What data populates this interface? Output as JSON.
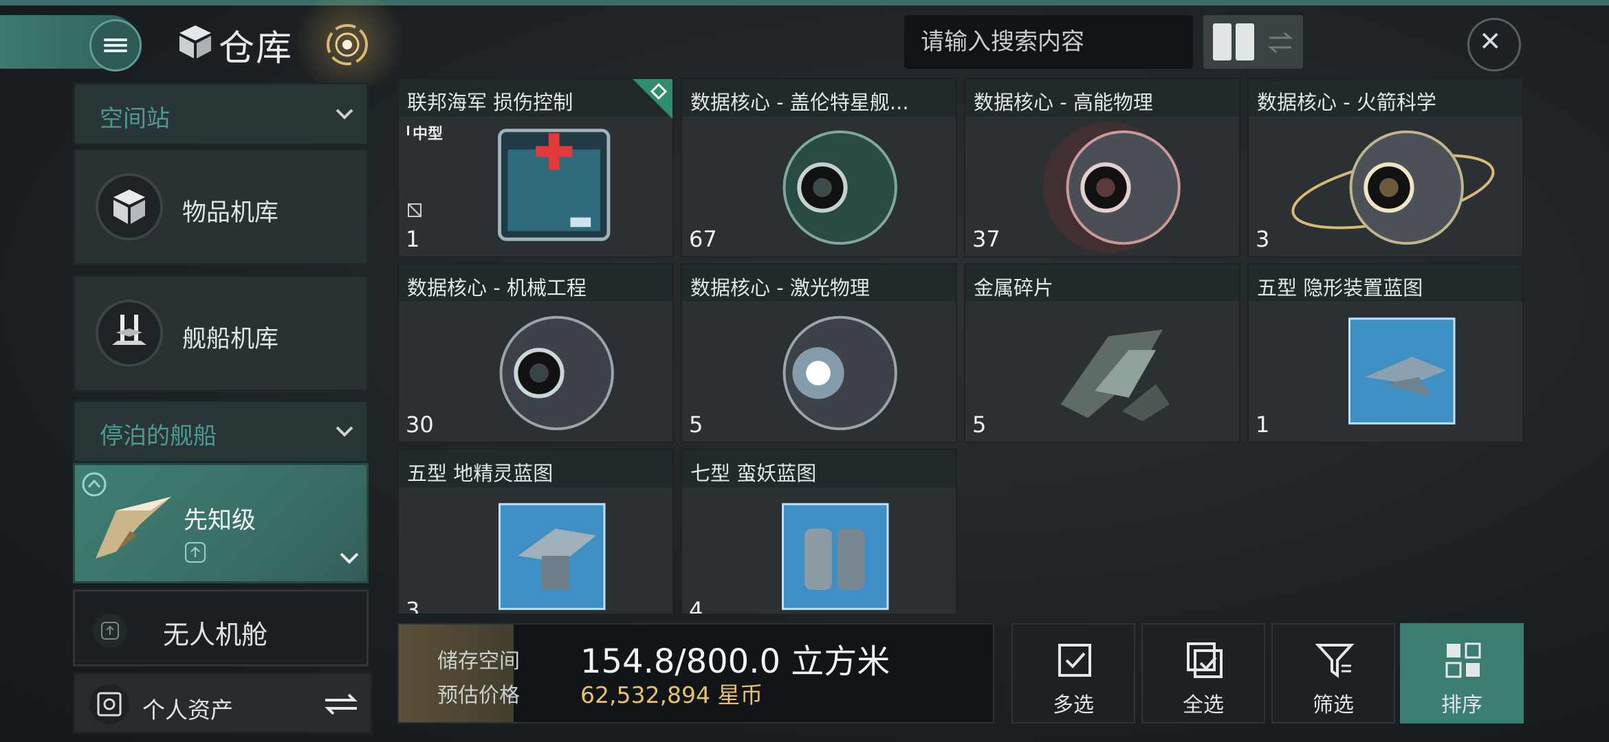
{
  "header": {
    "title": "仓库",
    "search": {
      "placeholder": "请输入搜索内容",
      "value": ""
    }
  },
  "sidebar": {
    "section_station": "空间站",
    "item_hangar": "物品机库",
    "ship_hangar": "舰船机库",
    "section_docked": "停泊的舰船",
    "ship_name": "先知级",
    "drone_bay": "无人机舱",
    "personal_assets": "个人资产"
  },
  "items": [
    {
      "name": "联邦海军 损伤控制",
      "qty": "1",
      "tier": "中型"
    },
    {
      "name": "数据核心 - 盖伦特星舰...",
      "qty": "67"
    },
    {
      "name": "数据核心 - 高能物理",
      "qty": "37"
    },
    {
      "name": "数据核心 - 火箭科学",
      "qty": "3"
    },
    {
      "name": "数据核心 - 机械工程",
      "qty": "30"
    },
    {
      "name": "数据核心 - 激光物理",
      "qty": "5"
    },
    {
      "name": "金属碎片",
      "qty": "5"
    },
    {
      "name": "五型 隐形装置蓝图",
      "qty": "1"
    },
    {
      "name": "五型 地精灵蓝图",
      "qty": "3"
    },
    {
      "name": "七型 蛮妖蓝图",
      "qty": "4"
    }
  ],
  "storage": {
    "space_label": "储存空间",
    "price_label": "预估价格",
    "space_value": "154.8/800.0 立方米",
    "price_value": "62,532,894 星币",
    "fill_ratio": 0.1935
  },
  "actions": {
    "multi_select": "多选",
    "select_all": "全选",
    "filter": "筛选",
    "sort": "排序"
  },
  "colors": {
    "accent": "#3b7d71",
    "currency": "#e9c06a",
    "label_teal": "#4a9c8d"
  },
  "icons": [
    "menu-icon",
    "cube-icon",
    "target-icon",
    "search-icon",
    "grid-view-icon",
    "swap-icon",
    "close-icon",
    "chevron-down-icon",
    "checkbox-icon",
    "select-all-icon",
    "filter-icon",
    "sort-icon"
  ]
}
